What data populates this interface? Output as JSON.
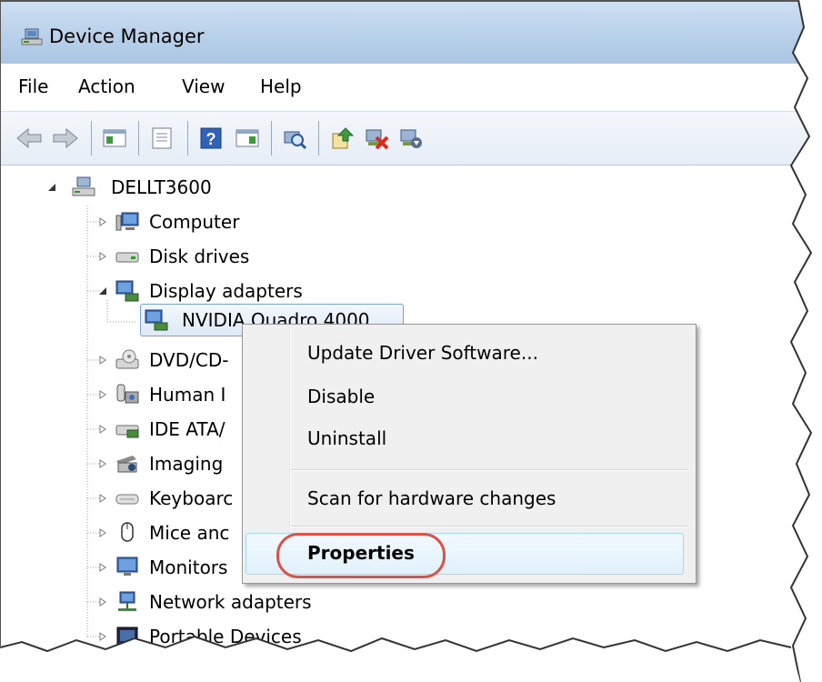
{
  "window": {
    "title": "Device Manager"
  },
  "menu": [
    "File",
    "Action",
    "View",
    "Help"
  ],
  "toolbar": [
    "back-icon",
    "forward-icon",
    "show-hide-console-tree-icon",
    "properties-icon",
    "help-icon",
    "action-pane-icon",
    "scan-hardware-icon",
    "update-driver-icon",
    "uninstall-icon",
    "enable-device-icon"
  ],
  "tree": {
    "root": "DELLT3600",
    "items": [
      "Computer",
      "Disk drives",
      "Display adapters",
      "NVIDIA Quadro 4000",
      "DVD/CD-",
      "Human I",
      "IDE ATA/",
      "Imaging",
      "Keyboarc",
      "Mice anc",
      "Monitors",
      "Network adapters",
      "Portable Devices"
    ]
  },
  "context_menu": {
    "items": [
      "Update Driver Software...",
      "Disable",
      "Uninstall",
      "Scan for hardware changes",
      "Properties"
    ],
    "highlighted": "Properties"
  },
  "colors": {
    "titlebar": "#b9d1ea",
    "highlight_circle": "#d9534a",
    "selection_border": "#7da2ce"
  }
}
